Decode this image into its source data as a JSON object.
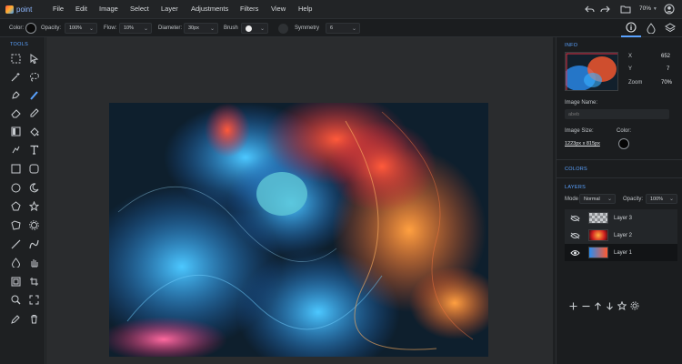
{
  "app": {
    "name": "point"
  },
  "menu": {
    "items": [
      "File",
      "Edit",
      "Image",
      "Select",
      "Layer",
      "Adjustments",
      "Filters",
      "View",
      "Help"
    ]
  },
  "topbar": {
    "zoom": "70%"
  },
  "options": {
    "color_label": "Color:",
    "opacity_label": "Opacity:",
    "opacity_value": "100%",
    "flow_label": "Flow:",
    "flow_value": "10%",
    "diameter_label": "Diameter:",
    "diameter_value": "30px",
    "brush_label": "Brush",
    "symmetry_label": "Symmetry",
    "symmetry_value": "6"
  },
  "tools_title": "TOOLS",
  "info": {
    "title": "INFO",
    "x_label": "X",
    "x_value": "652",
    "y_label": "Y",
    "y_value": "7",
    "zoom_label": "Zoom",
    "zoom_value": "70%",
    "image_name_label": "Image Name:",
    "image_name_placeholder": "abeb",
    "image_size_label": "Image Size:",
    "image_size_value": "1223px x 815px",
    "color_label": "Color:"
  },
  "colors": {
    "title": "COLORS"
  },
  "layers": {
    "title": "LAYERS",
    "mode_label": "Mode",
    "mode_value": "Normal",
    "opacity_label": "Opacity:",
    "opacity_value": "100%",
    "items": [
      {
        "name": "Layer 3"
      },
      {
        "name": "Layer 2"
      },
      {
        "name": "Layer 1"
      }
    ]
  },
  "colors_accent": {
    "accent": "#5aa2ff",
    "bg": "#1e2022"
  }
}
